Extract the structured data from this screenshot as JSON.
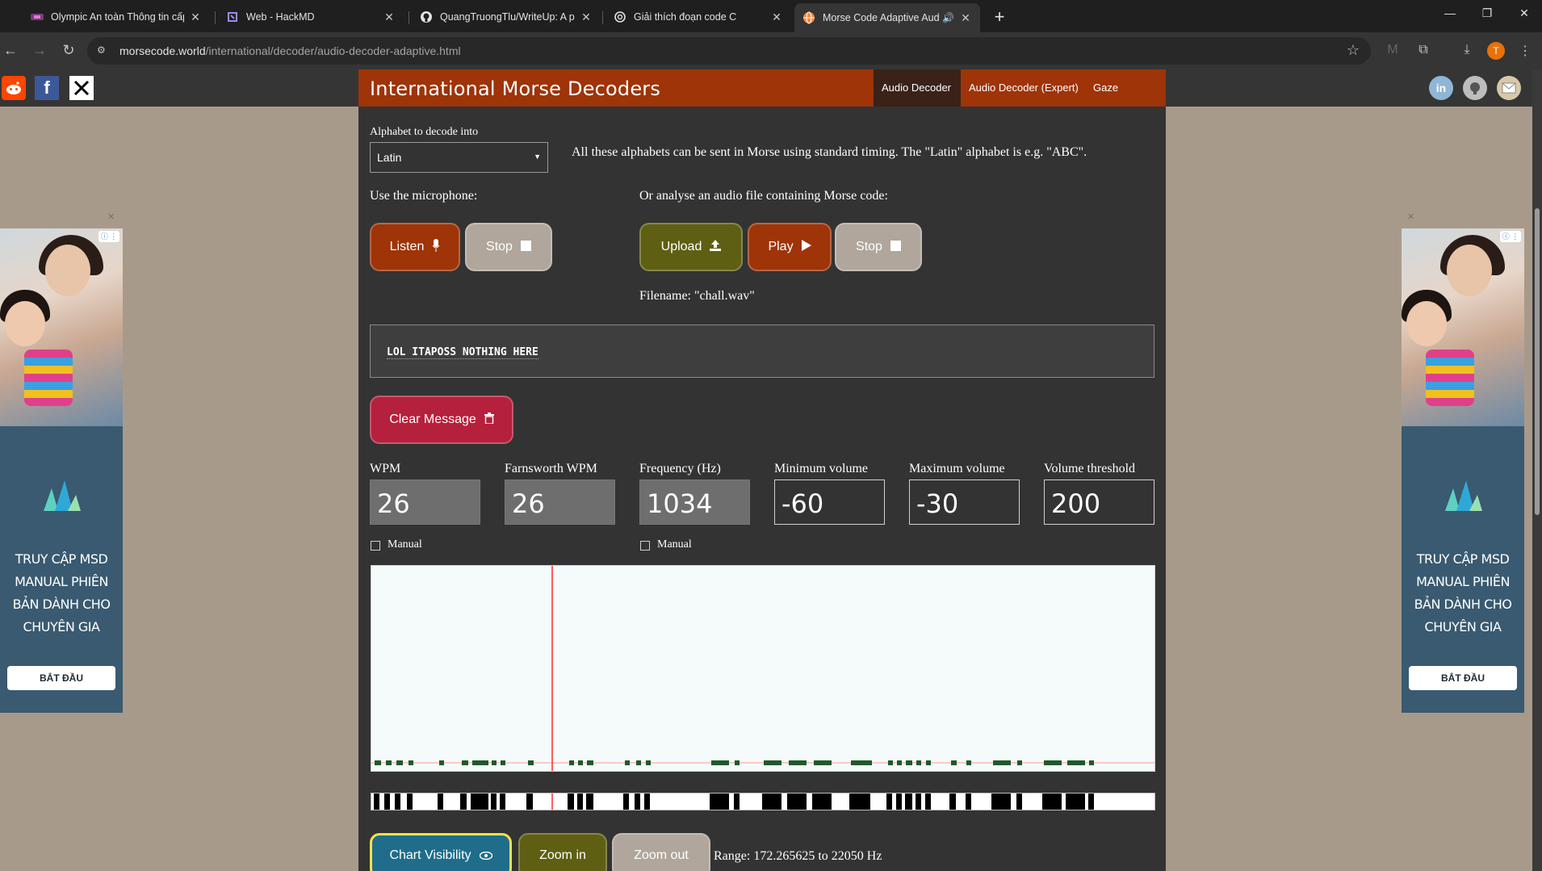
{
  "browser": {
    "tabs": [
      {
        "title": "Olympic An toàn Thông tin cấp",
        "icon": "ctf-icon"
      },
      {
        "title": "Web - HackMD",
        "icon": "hackmd-icon"
      },
      {
        "title": "QuangTruongTlu/WriteUp: A pl",
        "icon": "github-icon"
      },
      {
        "title": "Giải thích đoạn code C",
        "icon": "chatgpt-icon"
      },
      {
        "title": "Morse Code Adaptive Audi",
        "icon": "globe-icon"
      }
    ],
    "new_tab": "+",
    "url_host": "morsecode.world",
    "url_path": "/international/decoder/audio-decoder-adaptive.html",
    "profile_initial": "T",
    "min": "—",
    "restore": "❐",
    "close": "✕"
  },
  "site": {
    "title": "International Morse Decoders",
    "nav": [
      "Audio Decoder",
      "Audio Decoder (Expert)",
      "Gaze Decoder"
    ]
  },
  "decoder": {
    "alphabet_label": "Alphabet to decode into",
    "alphabet_value": "Latin",
    "alphabet_note": "All these alphabets can be sent in Morse using standard timing. The \"Latin\" alphabet is e.g. \"ABC\".",
    "mic_label": "Use the microphone:",
    "file_label": "Or analyse an audio file containing Morse code:",
    "listen": "Listen",
    "stop": "Stop",
    "upload": "Upload",
    "play": "Play",
    "filename": "Filename: \"chall.wav\"",
    "message": "LOL ITAPOSS NOTHING HERE",
    "clear": "Clear Message",
    "params": [
      {
        "label": "WPM",
        "value": "26"
      },
      {
        "label": "Farnsworth WPM",
        "value": "26"
      },
      {
        "label": "Frequency (Hz)",
        "value": "1034"
      },
      {
        "label": "Minimum volume",
        "value": "-60"
      },
      {
        "label": "Maximum volume",
        "value": "-30"
      },
      {
        "label": "Volume threshold",
        "value": "200"
      }
    ],
    "manual": "Manual",
    "chart_visibility": "Chart Visibility",
    "zoom_in": "Zoom in",
    "zoom_out": "Zoom out",
    "range": "Range: 172.265625 to 22050 Hz"
  },
  "ad": {
    "text_lines": [
      "TRUY CẬP MSD",
      "MANUAL PHIÊN",
      "BẢN DÀNH CHO",
      "CHUYÊN GIA"
    ],
    "cta": "BẮT ĐẦU"
  },
  "colors": {
    "accent": "#9e3408",
    "olive": "#5e5f12",
    "crimson": "#b5203d",
    "signal": "#1e5a2a"
  }
}
